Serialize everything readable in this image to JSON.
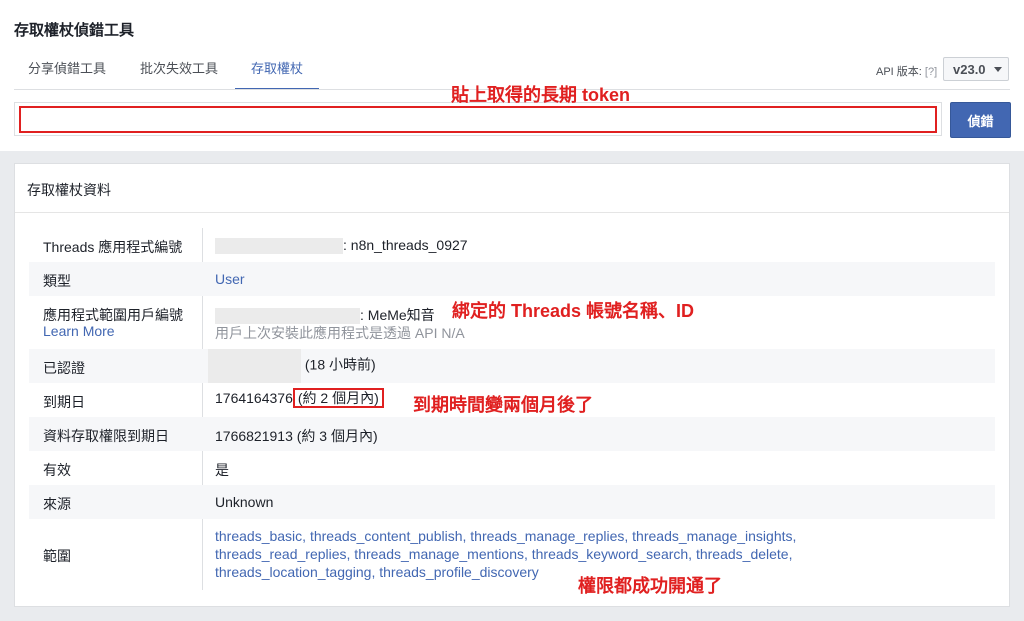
{
  "page_title": "存取權杖偵錯工具",
  "tabs": [
    {
      "label": "分享偵錯工具",
      "active": false
    },
    {
      "label": "批次失效工具",
      "active": false
    },
    {
      "label": "存取權杖",
      "active": true
    }
  ],
  "api": {
    "label": "API 版本:",
    "help": "[?]",
    "version": "v23.0"
  },
  "token_input": {
    "value": "",
    "placeholder": ""
  },
  "debug_button": "偵錯",
  "annotations": {
    "token": "貼上取得的長期 token",
    "account": "綁定的 Threads 帳號名稱、ID",
    "expiry": "到期時間變兩個月後了",
    "scopes": "權限都成功開通了"
  },
  "card_title": "存取權杖資料",
  "info": {
    "app_id": {
      "label": "Threads 應用程式編號",
      "value": ": n8n_threads_0927"
    },
    "type": {
      "label": "類型",
      "value": "User"
    },
    "user_id": {
      "label": "應用程式範圍用戶編號",
      "learn_more": "Learn More",
      "value": ": MeMe知音",
      "note": "用戶上次安裝此應用程式是透過 API N/A"
    },
    "issued": {
      "label": "已認證",
      "value": "(18 小時前)"
    },
    "expires": {
      "label": "到期日",
      "timestamp": "1764164376",
      "relative": "(約 2 個月內)"
    },
    "data_access": {
      "label": "資料存取權限到期日",
      "value": "1766821913 (約 3 個月內)"
    },
    "valid": {
      "label": "有效",
      "value": "是"
    },
    "origin": {
      "label": "來源",
      "value": "Unknown"
    },
    "scopes": {
      "label": "範圍",
      "line1": "threads_basic, threads_content_publish, threads_manage_replies, threads_manage_insights,",
      "line2": "threads_read_replies, threads_manage_mentions, threads_keyword_search, threads_delete,",
      "line3": "threads_location_tagging, threads_profile_discovery"
    }
  },
  "colors": {
    "accent": "#4267b2",
    "annotation": "#e02020",
    "background": "#e9ebee"
  }
}
